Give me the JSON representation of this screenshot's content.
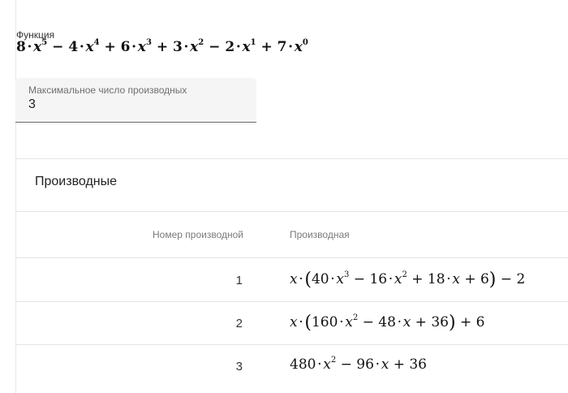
{
  "function": {
    "label": "Функция",
    "formula_text": "8·x^5 − 4·x^4 + 6·x^3 + 3·x^2 − 2·x^1 + 7·x^0"
  },
  "max_derivatives": {
    "label": "Максимальное число производных",
    "value": "3"
  },
  "derivatives": {
    "title": "Производные",
    "columns": {
      "number": "Номер производной",
      "derivative": "Производная"
    },
    "rows": [
      {
        "number": "1",
        "derivative_text": "x·(40·x^3 − 16·x^2 + 18·x + 6) − 2"
      },
      {
        "number": "2",
        "derivative_text": "x·(160·x^2 − 48·x + 36) + 6"
      },
      {
        "number": "3",
        "derivative_text": "480·x^2 − 96·x + 36"
      }
    ]
  }
}
